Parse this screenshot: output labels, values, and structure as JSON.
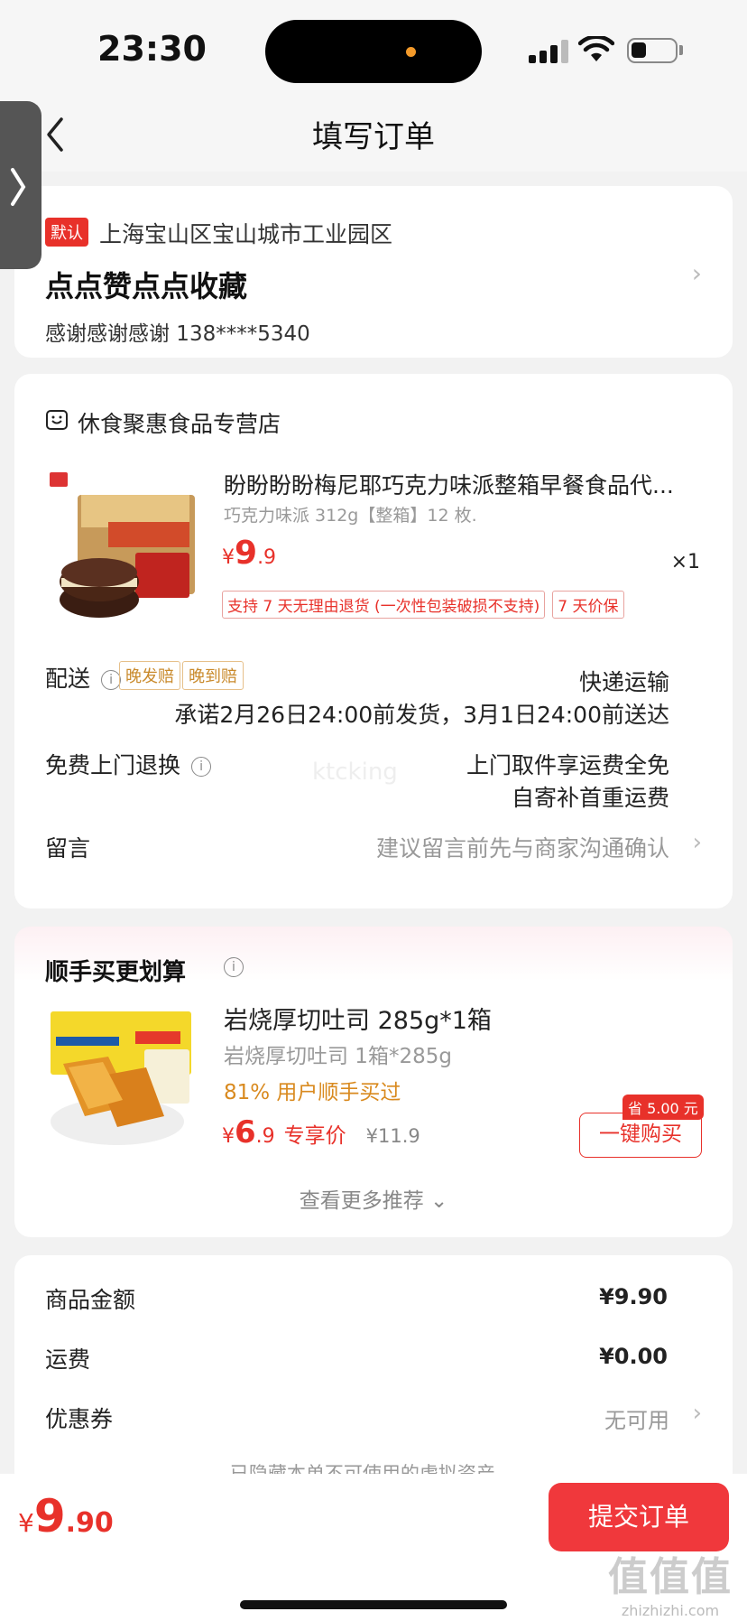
{
  "status_bar": {
    "time": "23:30"
  },
  "nav": {
    "title": "填写订单"
  },
  "address": {
    "default_tag": "默认",
    "line": "上海宝山区宝山城市工业园区",
    "name": "点点赞点点收藏",
    "contact": "感谢感谢感谢 138****5340"
  },
  "shop": {
    "name": "休食聚惠食品专营店"
  },
  "product": {
    "title": "盼盼盼盼梅尼耶巧克力味派整箱早餐食品代...",
    "spec": "巧克力味派 312g【整箱】12 枚.",
    "price_symbol": "¥",
    "price_int": "9",
    "price_dec": ".9",
    "qty": "×1",
    "tags": [
      "支持 7 天无理由退货 (一次性包装破损不支持)",
      "7 天价保"
    ]
  },
  "delivery": {
    "label": "配送",
    "tags": [
      "晚发赔",
      "晚到赔"
    ],
    "method": "快递运输",
    "promise": "承诺2月26日24:00前发货，3月1日24:00前送达"
  },
  "returns": {
    "label": "免费上门退换",
    "line1": "上门取件享运费全免",
    "line2": "自寄补首重运费"
  },
  "watermark": "ktcking",
  "message": {
    "label": "留言",
    "placeholder": "建议留言前先与商家沟通确认"
  },
  "recommend": {
    "title": "顺手买更划算",
    "name": "岩烧厚切吐司 285g*1箱",
    "spec": "岩烧厚切吐司 1箱*285g",
    "social": "81% 用户顺手买过",
    "price_symbol": "¥",
    "price_int": "6",
    "price_dec": ".9",
    "exclusive": "专享价",
    "original": "¥11.9",
    "save_badge": "省 5.00 元",
    "buy_label": "一键购买",
    "more_label": "查看更多推荐"
  },
  "summary": {
    "goods_label": "商品金额",
    "goods_value": "¥9.90",
    "shipping_label": "运费",
    "shipping_value": "¥0.00",
    "coupon_label": "优惠券",
    "coupon_value": "无可用",
    "hidden_assets": "已隐藏本单不可使用的虚拟资产"
  },
  "footer": {
    "price_symbol": "¥",
    "price_int": "9",
    "price_dec": ".90",
    "submit_label": "提交订单",
    "site_logo": "值值值",
    "site_url": "zhizhizhi.com"
  },
  "colors": {
    "accent": "#e8312a",
    "warning": "#c98a2c",
    "background": "#f2f2f2"
  }
}
